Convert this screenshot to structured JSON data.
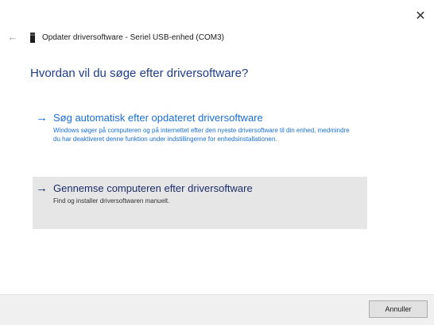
{
  "window": {
    "close_glyph": "✕",
    "back_glyph": "←",
    "title": "Opdater driversoftware - Seriel USB-enhed (COM3)"
  },
  "heading": "Hvordan vil du søge efter driversoftware?",
  "options": [
    {
      "arrow": "→",
      "title": "Søg automatisk efter opdateret driversoftware",
      "description": "Windows søger på computeren og på internettet efter den nyeste driversoftware til din enhed, medmindre du har deaktiveret denne funktion under indstillingerne for enhedsinstallationen.",
      "selected": false
    },
    {
      "arrow": "→",
      "title": "Gennemse computeren efter driversoftware",
      "description": "Find og installer driversoftwaren manuelt.",
      "selected": true
    }
  ],
  "footer": {
    "cancel_label": "Annuller"
  },
  "colors": {
    "heading": "#1e3d8c",
    "link": "#1a6fd6",
    "selected_bg": "#e6e6e6",
    "footer_bg": "#f0f0f0"
  },
  "icons": {
    "close": "close-icon",
    "back": "back-arrow-icon",
    "device": "usb-device-icon",
    "option_arrow": "arrow-right-icon"
  }
}
